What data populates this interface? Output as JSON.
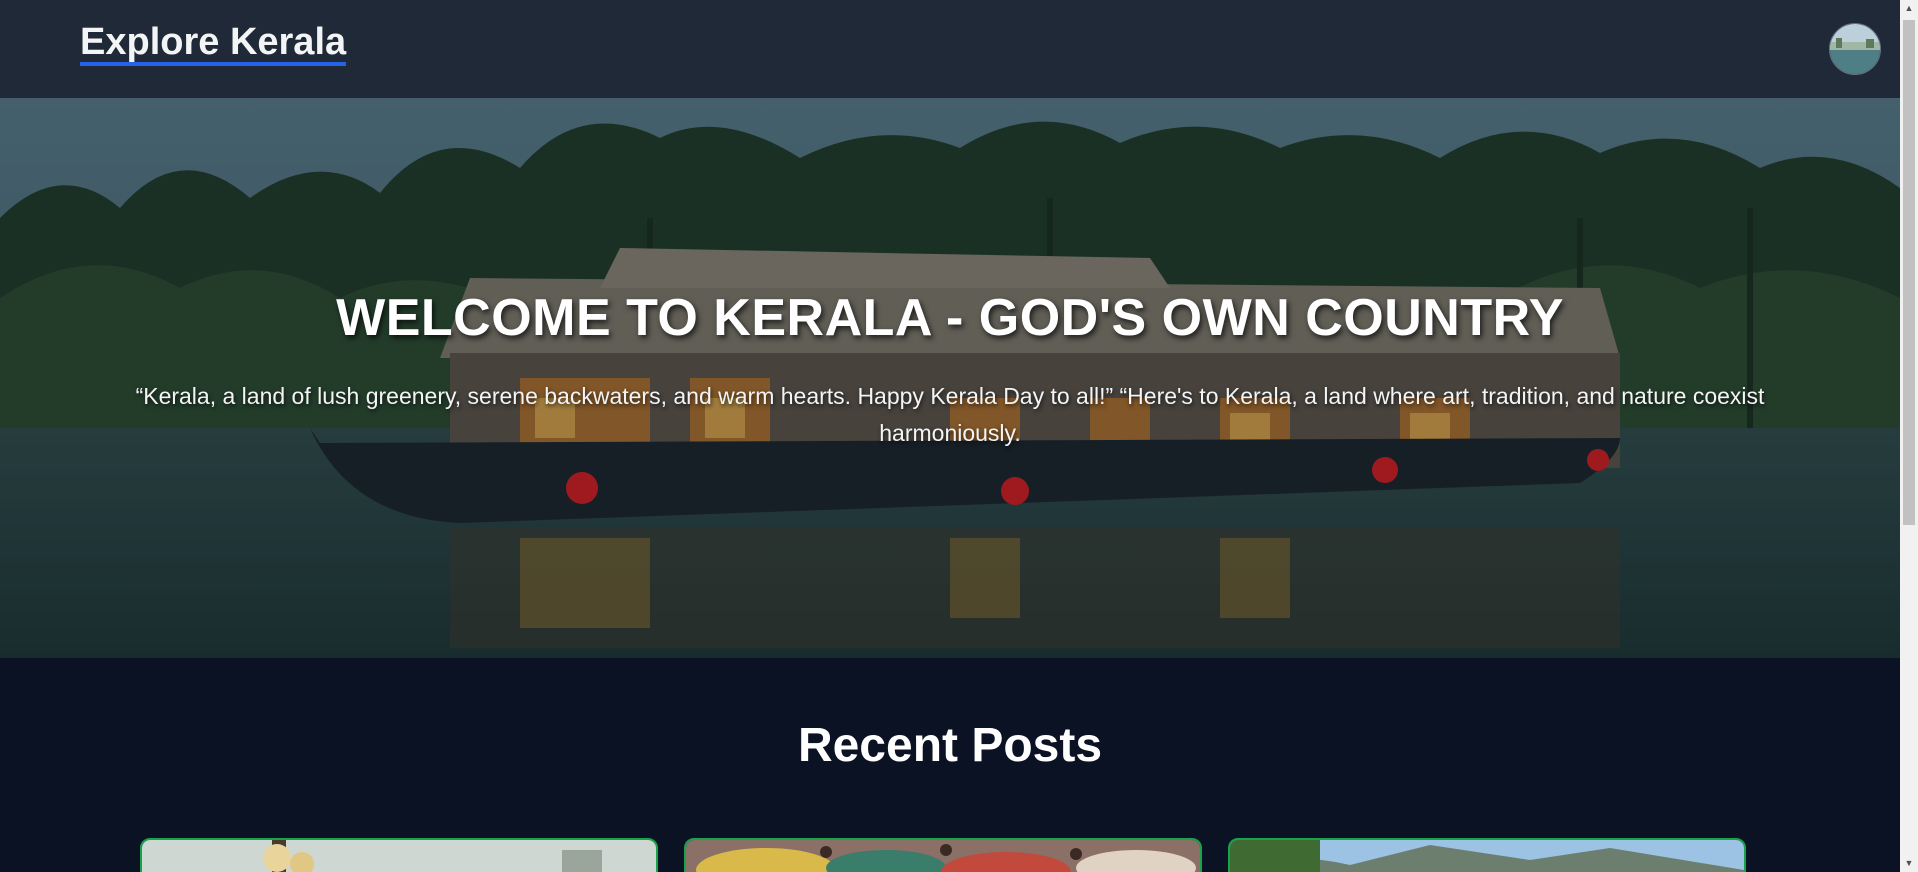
{
  "header": {
    "brand": "Explore Kerala",
    "avatar_icon": "profile-avatar-icon"
  },
  "hero": {
    "title": "WELCOME TO KERALA - GOD'S OWN COUNTRY",
    "text": "“Kerala, a land of lush greenery, serene backwaters, and warm hearts. Happy Kerala Day to all!” “Here's to Kerala, a land where art, tradition, and nature coexist harmoniously."
  },
  "recent_posts": {
    "title": "Recent Posts",
    "cards": [
      {
        "image_icon": "post-image-lantern"
      },
      {
        "image_icon": "post-image-festival-crowd"
      },
      {
        "image_icon": "post-image-mountain"
      }
    ]
  },
  "scrollbar": {
    "up_icon": "▲",
    "down_icon": "▼"
  },
  "colors": {
    "header_bg": "#1f2937",
    "page_bg": "#0b1224",
    "brand_underline": "#2563eb",
    "card_border": "#16a34a"
  }
}
